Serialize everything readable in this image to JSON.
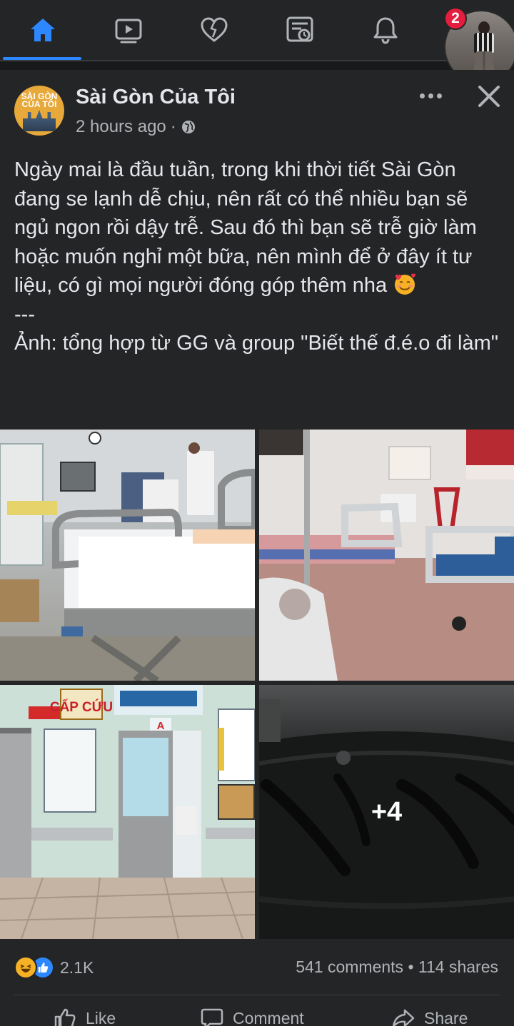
{
  "nav": {
    "items": [
      "home-icon",
      "video-icon",
      "heart-icon",
      "news-feed-icon",
      "bell-icon"
    ],
    "notification_badge": "2",
    "accent": "#2d88ff"
  },
  "post": {
    "page_name": "Sài Gòn Của Tôi",
    "timestamp": "2 hours ago",
    "separator": "·",
    "body_line1": "Ngày mai là đầu tuần, trong khi thời tiết Sài Gòn đang se lạnh dễ chịu, nên rất có thể nhiều bạn sẽ ngủ ngon rồi dậy trễ. Sau đó thì bạn sẽ trễ giờ làm hoặc muốn nghỉ một bữa, nên mình để ở đây ít tư liệu, có gì mọi người đóng góp thêm nha",
    "body_line2": "---\nẢnh: tổng hợp từ GG và group \"Biết thế đ.é.o đi làm\"",
    "photo3_sign": "CẤP CỨU",
    "photo3_door": "A",
    "more_photos": "+4",
    "reaction_count": "2.1K",
    "comments": "541 comments",
    "stat_sep": "•",
    "shares": "114 shares"
  },
  "actions": {
    "like": "Like",
    "comment": "Comment",
    "share": "Share"
  }
}
